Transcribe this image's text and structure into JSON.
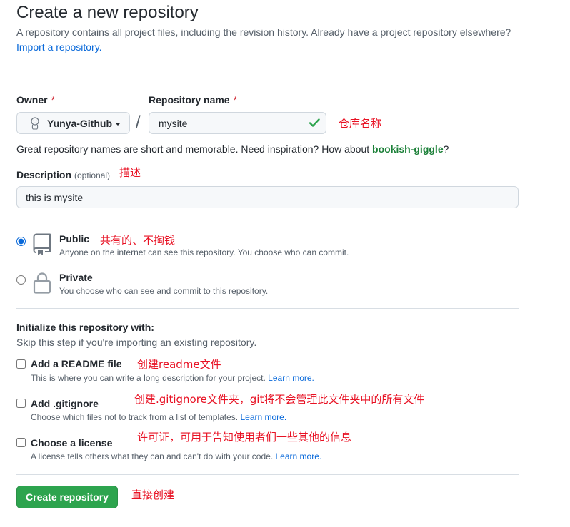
{
  "page": {
    "title": "Create a new repository",
    "subtitle": "A repository contains all project files, including the revision history. Already have a project repository elsewhere?",
    "import_link": "Import a repository."
  },
  "owner": {
    "label": "Owner",
    "required_mark": "*",
    "selected": "Yunya-Github",
    "avatar_icon": "avatar-icon",
    "dropdown_icon": "caret-down-icon"
  },
  "path_separator": "/",
  "repository_name": {
    "label": "Repository name",
    "required_mark": "*",
    "value": "mysite",
    "status_icon": "check-icon"
  },
  "name_hint": {
    "text": "Great repository names are short and memorable. Need inspiration? How about ",
    "suggestion": "bookish-giggle",
    "suffix": "?"
  },
  "description": {
    "label": "Description",
    "optional": "(optional)",
    "value": "this is mysite"
  },
  "visibility": [
    {
      "label": "Public",
      "note": "Anyone on the internet can see this repository. You choose who can commit.",
      "icon": "repo-icon",
      "checked": true
    },
    {
      "label": "Private",
      "note": "You choose who can see and commit to this repository.",
      "icon": "lock-icon",
      "checked": false
    }
  ],
  "initialize": {
    "heading": "Initialize this repository with:",
    "hint": "Skip this step if you're importing an existing repository.",
    "options": [
      {
        "label": "Add a README file",
        "note": "This is where you can write a long description for your project.",
        "link": "Learn more.",
        "checked": false
      },
      {
        "label": "Add .gitignore",
        "note": "Choose which files not to track from a list of templates.",
        "link": "Learn more.",
        "checked": false
      },
      {
        "label": "Choose a license",
        "note": "A license tells others what they can and can't do with your code.",
        "link": "Learn more.",
        "checked": false
      }
    ]
  },
  "submit": {
    "label": "Create repository"
  },
  "annotations": {
    "repository_name": "仓库名称",
    "description": "描述",
    "public": "共有的、不掏钱",
    "readme": "创建readme文件",
    "gitignore": "创建.gitignore文件夹，git将不会管理此文件夹中的所有文件",
    "license": "许可证，可用于告知使用者们一些其他的信息",
    "create": "直接创建"
  },
  "colors": {
    "text": "#24292f",
    "muted": "#57606a",
    "link": "#0969da",
    "border": "#d0d7de",
    "required": "#cf222e",
    "success": "#2da44e",
    "suggestion": "#1a7f37",
    "primary_button": "#2da44e",
    "annotation": "#e81123"
  }
}
